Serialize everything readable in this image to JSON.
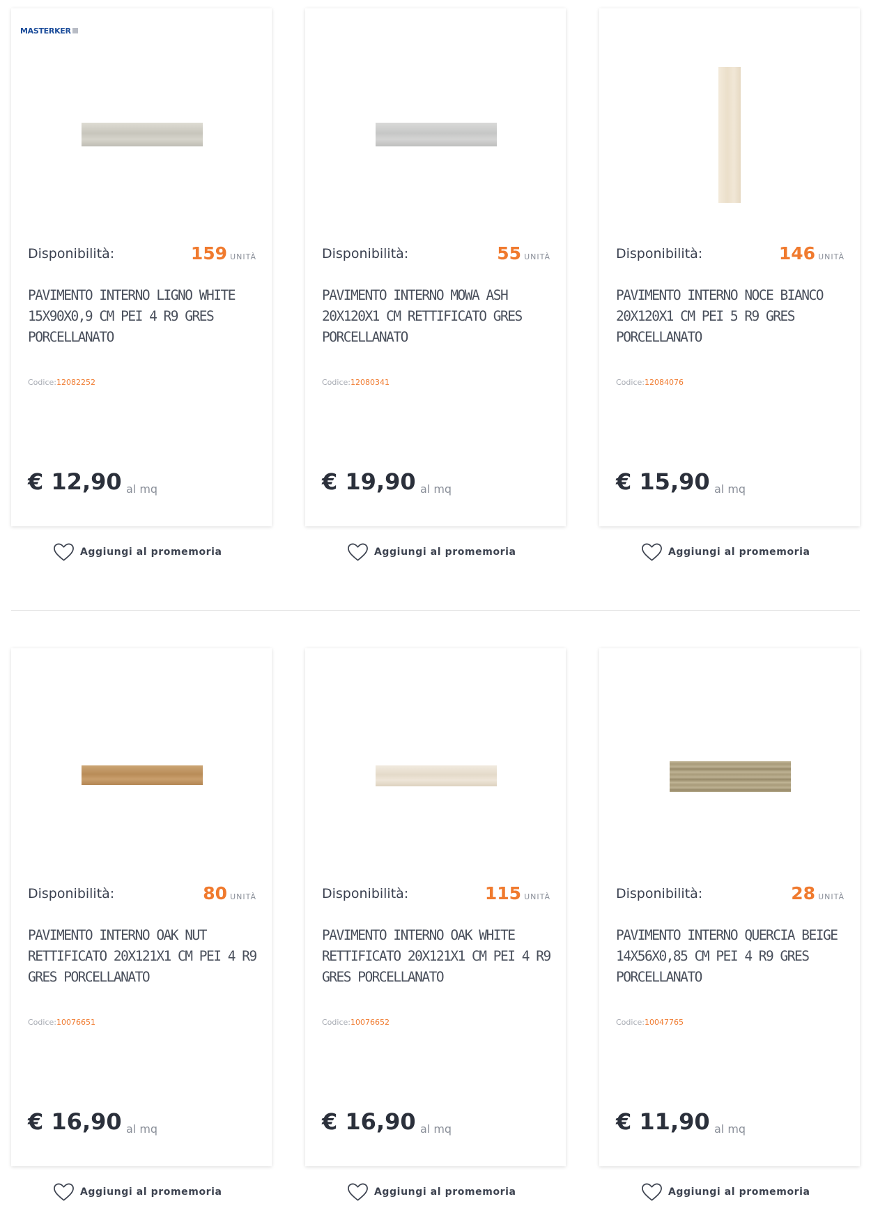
{
  "products": [
    {
      "brand": "MASTERKER",
      "availability_label": "Disponibilità:",
      "availability_count": "159",
      "availability_unit": "UNITÀ",
      "name": "PAVIMENTO INTERNO LIGNO WHITE 15X90X0,9 CM PEI 4 R9 GRES PORCELLANATO",
      "code_label": "Codice:",
      "code": "12082252",
      "price": "€ 12,90",
      "price_unit": "al mq",
      "reminder_label": "Aggiungi al promemoria",
      "tile_color": "#d2d0c7"
    },
    {
      "availability_label": "Disponibilità:",
      "availability_count": "55",
      "availability_unit": "UNITÀ",
      "name": "PAVIMENTO INTERNO MOWA ASH 20X120X1 CM RETTIFICATO GRES PORCELLANATO",
      "code_label": "Codice:",
      "code": "12080341",
      "price": "€ 19,90",
      "price_unit": "al mq",
      "reminder_label": "Aggiungi al promemoria",
      "tile_color": "#cfd0cf"
    },
    {
      "availability_label": "Disponibilità:",
      "availability_count": "146",
      "availability_unit": "UNITÀ",
      "name": "PAVIMENTO INTERNO NOCE BIANCO 20X120X1 CM PEI 5 R9 GRES PORCELLANATO",
      "code_label": "Codice:",
      "code": "12084076",
      "price": "€ 15,90",
      "price_unit": "al mq",
      "reminder_label": "Aggiungi al promemoria",
      "tile_color": "#efe4d1"
    },
    {
      "availability_label": "Disponibilità:",
      "availability_count": "80",
      "availability_unit": "UNITÀ",
      "name": "PAVIMENTO INTERNO OAK NUT RETTIFICATO 20X121X1 CM PEI 4 R9 GRES PORCELLANATO",
      "code_label": "Codice:",
      "code": "10076651",
      "price": "€ 16,90",
      "price_unit": "al mq",
      "reminder_label": "Aggiungi al promemoria",
      "tile_color": "#c39a69"
    },
    {
      "availability_label": "Disponibilità:",
      "availability_count": "115",
      "availability_unit": "UNITÀ",
      "name": "PAVIMENTO INTERNO OAK WHITE RETTIFICATO 20X121X1 CM PEI 4 R9 GRES PORCELLANATO",
      "code_label": "Codice:",
      "code": "10076652",
      "price": "€ 16,90",
      "price_unit": "al mq",
      "reminder_label": "Aggiungi al promemoria",
      "tile_color": "#ebe3d5"
    },
    {
      "availability_label": "Disponibilità:",
      "availability_count": "28",
      "availability_unit": "UNITÀ",
      "name": "PAVIMENTO INTERNO QUERCIA BEIGE 14X56X0,85 CM PEI 4 R9 GRES PORCELLANATO",
      "code_label": "Codice:",
      "code": "10047765",
      "price": "€ 11,90",
      "price_unit": "al mq",
      "reminder_label": "Aggiungi al promemoria",
      "tile_color": "#b6a98a"
    }
  ],
  "colors": {
    "accent": "#f07a2e",
    "text": "#3b4150",
    "price": "#2b303b",
    "brand": "#1b4c9a"
  }
}
